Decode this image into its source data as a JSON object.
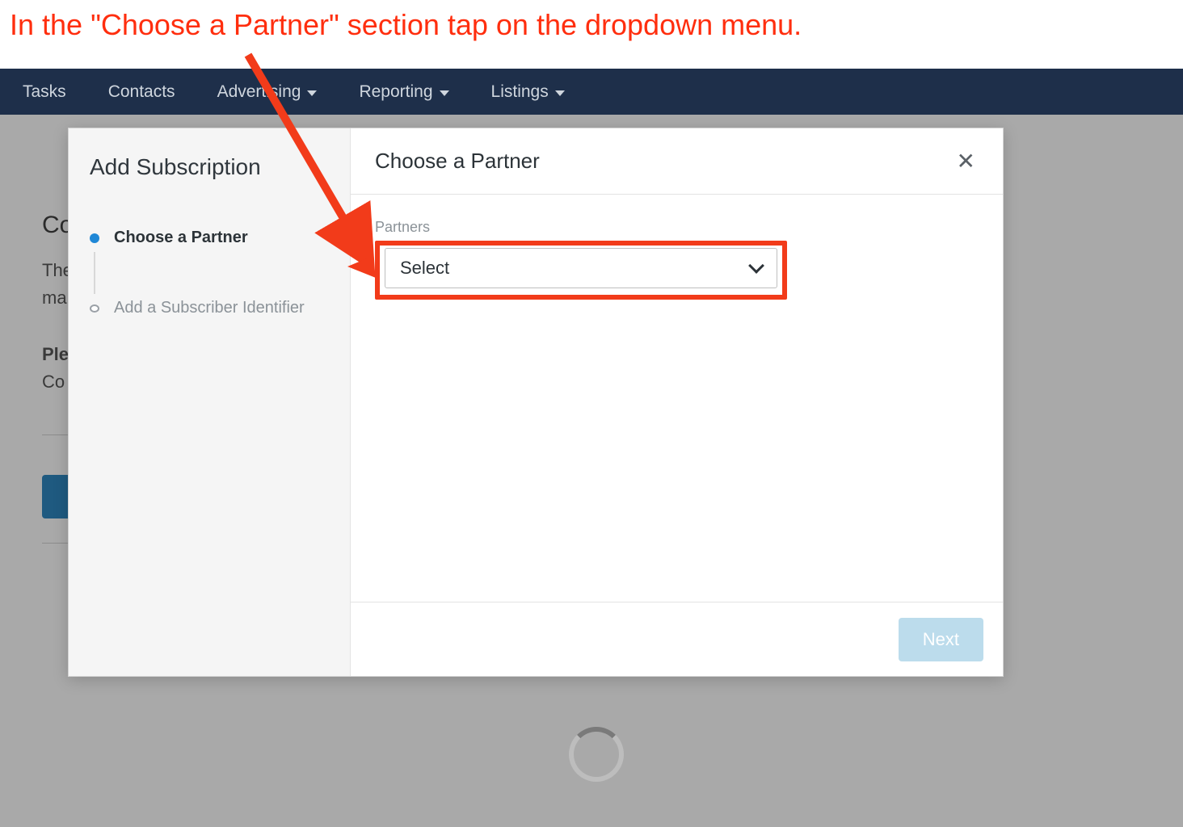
{
  "instruction": "In the \"Choose a Partner\" section tap on the dropdown menu.",
  "topnav": {
    "items": [
      {
        "label": "Tasks",
        "has_dropdown": false
      },
      {
        "label": "Contacts",
        "has_dropdown": false
      },
      {
        "label": "Advertising",
        "has_dropdown": true
      },
      {
        "label": "Reporting",
        "has_dropdown": true
      },
      {
        "label": "Listings",
        "has_dropdown": true
      }
    ]
  },
  "background": {
    "heading_fragment": "Co",
    "line1": "The",
    "line2": "ma",
    "line3_bold": "Ple",
    "line4": "Co"
  },
  "modal": {
    "sidebar_title": "Add Subscription",
    "steps": [
      {
        "label": "Choose a Partner",
        "active": true
      },
      {
        "label": "Add a Subscriber Identifier",
        "active": false
      }
    ],
    "main_title": "Choose a Partner",
    "close_glyph": "✕",
    "partners_label": "Partners",
    "dropdown_selected": "Select",
    "next_label": "Next"
  },
  "colors": {
    "annotation_red": "#f23b1a",
    "nav_bg": "#1e2f4a",
    "primary_accent": "#1f87d6",
    "next_button_bg": "#bcdcec"
  }
}
